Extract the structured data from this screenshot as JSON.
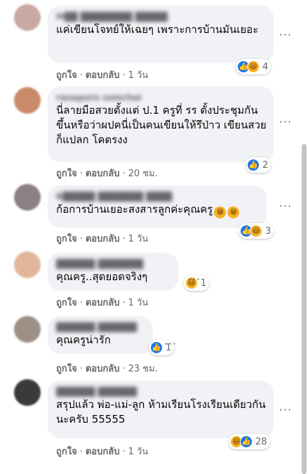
{
  "common": {
    "like_label": "ถูกใจ",
    "reply_label": "ตอบกลับ",
    "separator": "·",
    "more_label": "···"
  },
  "comments": [
    {
      "author": "M██ ████████ █████",
      "text": "แค่เขียนโจทย์ให้เฉยๆ เพราะการบ้านมันเยอะ",
      "time": "1 วัน",
      "reaction_count": "4",
      "reactions": [
        "like-icon",
        "haha-icon"
      ],
      "avatar_color": "#c9a9a1"
    },
    {
      "author": "ranaporn somchai",
      "text": "นี่ลายมือสวยตั้งแต่ ป.1 ครูที่ รร ตั้งประชุมกันขึ้นหรือว่าผปคนี่เป็นคนเขียนให้รึป่าว เขียนสวยก็แปลก โคตรงง",
      "time": "20 ชม.",
      "reaction_count": "2",
      "reactions": [
        "like-icon"
      ],
      "avatar_color": "#c98a6a"
    },
    {
      "author": "B█████ ███████ ████",
      "text": "ก้อการบ้านเยอะสงสารลูกค่ะคุณครู",
      "time": "1 วัน",
      "reaction_count": "3",
      "reactions": [
        "like-icon",
        "haha-icon"
      ],
      "avatar_color": "#8c7f86"
    },
    {
      "author": "██████ ███████",
      "text": "คุณครู..สุดยอดจริงๆ",
      "time": "1 วัน",
      "reaction_count": "1",
      "reactions": [
        "haha-icon"
      ],
      "avatar_color": "#e0b79a"
    },
    {
      "author": "██████ ██████",
      "text": "คุณครูน่ารัก",
      "time": "23 ชม.",
      "reaction_count": "1",
      "reactions": [
        "like-icon"
      ],
      "avatar_color": "#9c8f86"
    },
    {
      "author": "██████ ██████",
      "text": "สรุปแล้ว พ่อ-แม่-ลูก ห้ามเรียนโรงเรียนเดียวกันนะครับ 55555",
      "time": "1 วัน",
      "reaction_count": "28",
      "reactions": [
        "haha-icon",
        "like-icon"
      ],
      "avatar_color": "#3a3a3a"
    }
  ]
}
